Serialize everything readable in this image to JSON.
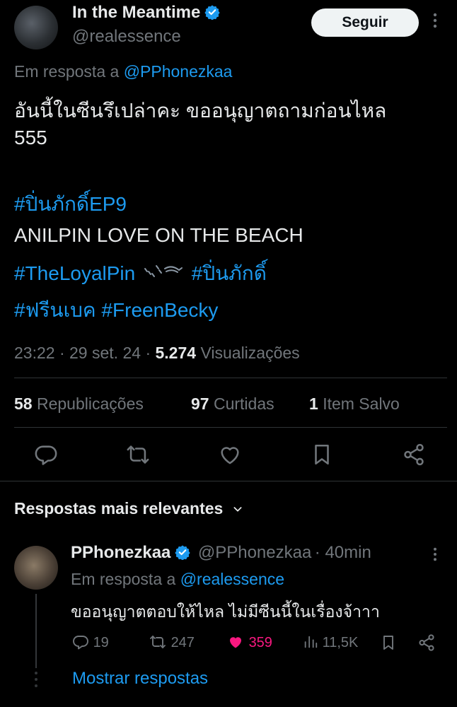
{
  "tweet": {
    "author_name": "In the Meantime",
    "author_handle": "@realessence",
    "follow_label": "Seguir",
    "reply_prefix": "Em resposta a",
    "reply_to_handle": "@PPhonezkaa",
    "text_line1": "อันนี้ในซีนรึเปล่าคะ ขออนุญาตถามก่อนไหล",
    "text_line2": "555",
    "hashtag_ep": "#ปิ่นภักดิ์EP9",
    "text_line3": "ANILPIN LOVE ON THE BEACH",
    "hashtag_loyal": "#TheLoyalPin",
    "hashtag_pin": "#ปิ่นภักดิ์",
    "hashtag_freen_thai": "#ฟรีนเบค",
    "hashtag_freen": "#FreenBecky",
    "time": "23:22",
    "date": "29 set. 24",
    "views_count": "5.274",
    "views_label": "Visualizações",
    "reposts_count": "58",
    "reposts_label": "Republicações",
    "likes_count": "97",
    "likes_label": "Curtidas",
    "saved_count": "1",
    "saved_label": "Item Salvo"
  },
  "replies_section": {
    "title": "Respostas mais relevantes"
  },
  "reply": {
    "author_name": "PPhonezkaa",
    "author_handle": "@PPhonezkaa",
    "time_ago": "40min",
    "reply_prefix": "Em resposta a",
    "reply_to_handle": "@realessence",
    "text": "ขออนุญาตตอบให้ไหล ไม่มีซีนนี้ในเรื่องจ้าาา",
    "replies": "19",
    "reposts": "247",
    "likes": "359",
    "views": "11,5K",
    "show_replies_label": "Mostrar respostas"
  },
  "colors": {
    "accent": "#1d9bf0",
    "like_active": "#f91880",
    "muted": "#71767b",
    "background": "#000000"
  }
}
